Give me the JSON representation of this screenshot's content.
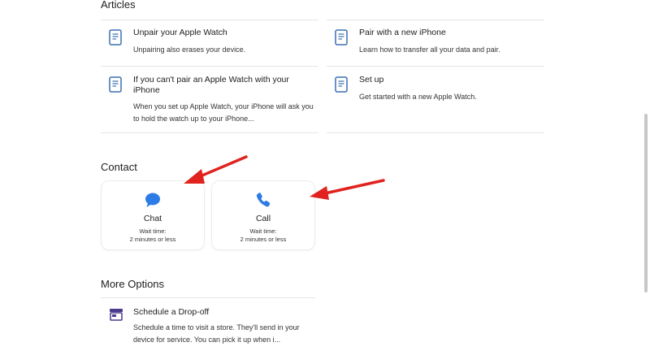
{
  "sections": {
    "articles": "Articles",
    "contact": "Contact",
    "more_options": "More Options"
  },
  "articles": [
    {
      "title": "Unpair your Apple Watch",
      "description": "Unpairing also erases your device.",
      "icon": "document-icon"
    },
    {
      "title": "Pair with a new iPhone",
      "description": "Learn how to transfer all your data and pair.",
      "icon": "document-icon"
    },
    {
      "title": "If you can't pair an Apple Watch with your iPhone",
      "description": "When you set up Apple Watch, your iPhone will ask you to hold the watch up to your iPhone...",
      "icon": "document-icon"
    },
    {
      "title": "Set up",
      "description": "Get started with a new Apple Watch.",
      "icon": "document-icon"
    }
  ],
  "contact": [
    {
      "label": "Chat",
      "wait_label": "Wait time:",
      "wait_value": "2 minutes or less",
      "icon": "chat-bubble-icon"
    },
    {
      "label": "Call",
      "wait_label": "Wait time:",
      "wait_value": "2 minutes or less",
      "icon": "phone-icon"
    }
  ],
  "more_options": [
    {
      "title": "Schedule a Drop-off",
      "description": "Schedule a time to visit a store. They'll send in your device for service. You can pick it up when i...",
      "icon": "store-icon"
    }
  ],
  "colors": {
    "accent": "#2d7be5",
    "doc_icon": "#3a6fb0",
    "store_icon": "#4b3a8c",
    "arrow": "#e0231e",
    "divider": "#e6e6e6"
  }
}
